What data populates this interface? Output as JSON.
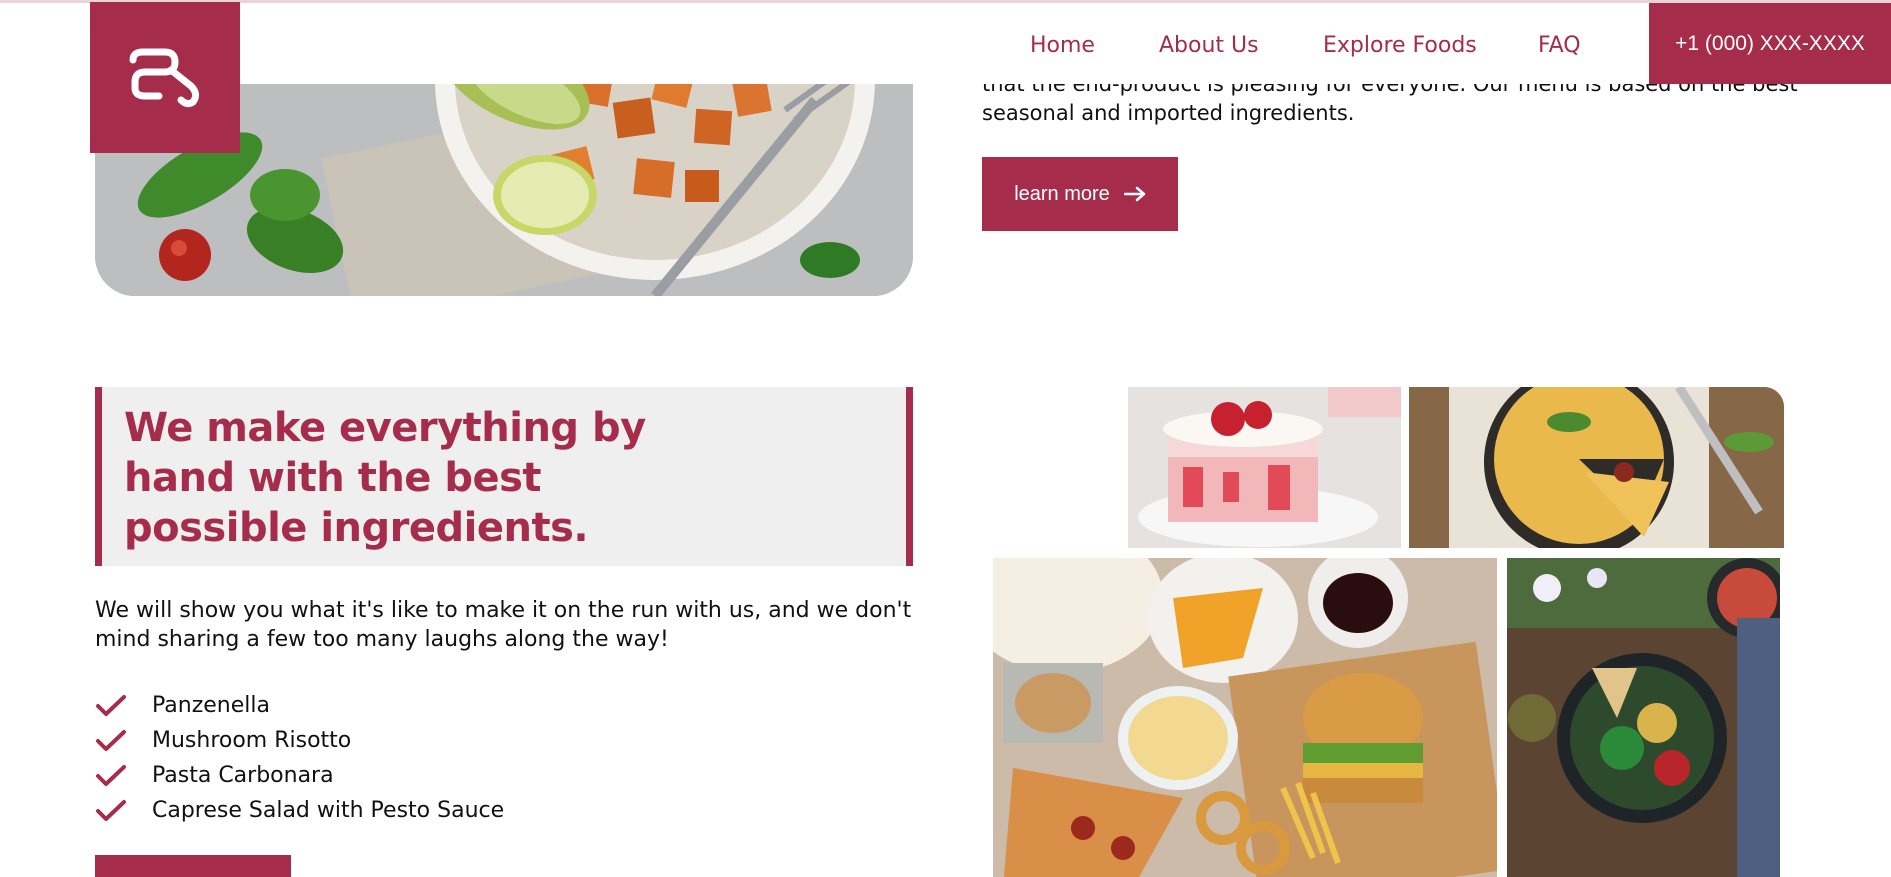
{
  "header": {
    "logo_alt": "brand-logo",
    "nav": [
      {
        "label": "Home"
      },
      {
        "label": "About Us"
      },
      {
        "label": "Explore Foods"
      },
      {
        "label": "FAQ"
      }
    ],
    "phone": "+1 (000) XXX-XXXX"
  },
  "about": {
    "text": "that the end-product is pleasing for everyone. Our menu is based on the best seasonal and imported ingredients.",
    "button_label": "learn more"
  },
  "handmade": {
    "heading": "We make everything by hand with the best possible ingredients.",
    "intro": "We will show you what it's like to make it on the run with us, and we don't mind sharing a few too many laughs along the way!",
    "items": [
      {
        "label": "Panzenella"
      },
      {
        "label": "Mushroom Risotto"
      },
      {
        "label": "Pasta Carbonara"
      },
      {
        "label": "Caprese Salad with Pesto Sauce"
      }
    ]
  },
  "colors": {
    "accent": "#a62c4b",
    "panel": "#f0eff0"
  }
}
